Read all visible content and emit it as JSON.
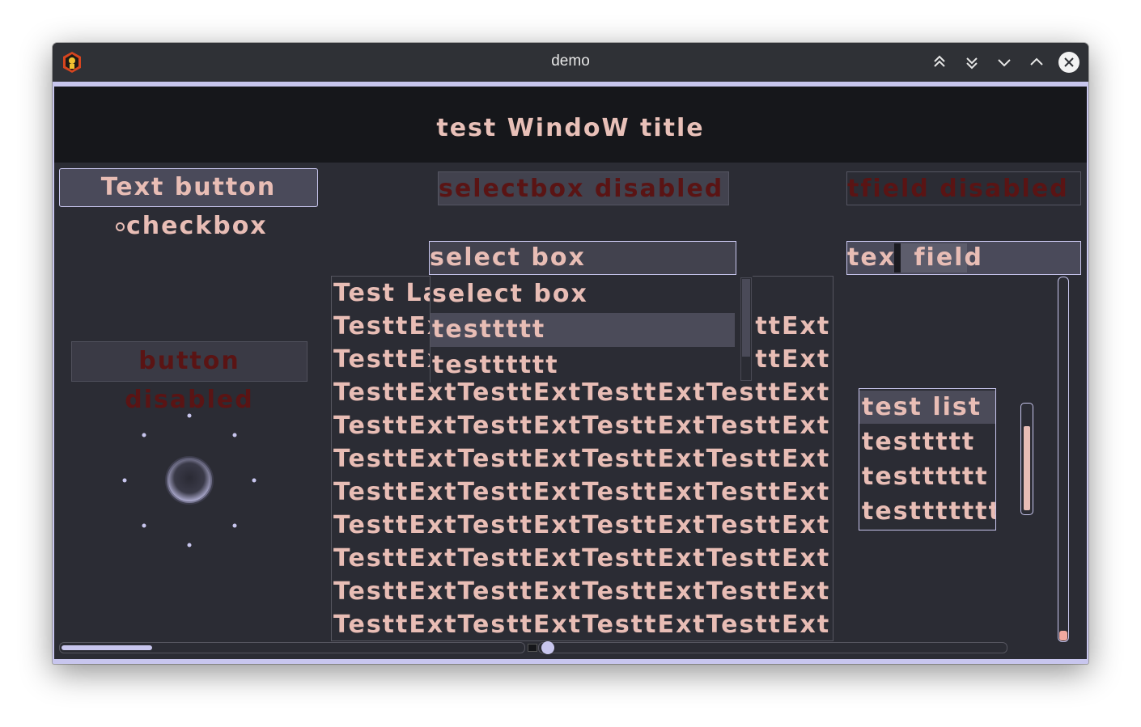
{
  "window": {
    "title": "demo",
    "controls": [
      "keep-above-icon",
      "keep-below-icon",
      "minimize-icon",
      "maximize-icon",
      "close-icon"
    ]
  },
  "header": {
    "title": "test WindoW title"
  },
  "text_button": {
    "label": "Text button"
  },
  "checkbox": {
    "label": "checkbox",
    "checked": false
  },
  "button_disabled": {
    "label": "button disabled"
  },
  "selectbox_disabled": {
    "value": "selectbox disabled"
  },
  "tfield_disabled": {
    "value": "tfield disabled"
  },
  "select_box": {
    "value": "select box",
    "options": [
      "select box",
      "testtttt",
      "testttttt"
    ]
  },
  "text_field": {
    "value": "text field",
    "visible_left": "tex",
    "visible_right": " field"
  },
  "text_area": {
    "lines": [
      "Test La",
      "TesttExtTesttExtTesttExtTesttExt",
      "TesttExtTesttExtTesttExtTesttExt",
      "TesttExtTesttExtTesttExtTesttExt",
      "TesttExtTesttExtTesttExtTesttExt",
      "TesttExtTesttExtTesttExtTesttExt",
      "TesttExtTesttExtTesttExtTesttExt",
      "TesttExtTesttExtTesttExtTesttExt",
      "TesttExtTesttExtTesttExtTesttExt",
      "TesttExtTesttExtTesttExtTesttExt",
      "TesttExtTesttExtTesttExtTesttExt"
    ]
  },
  "test_list": {
    "items": [
      "test list",
      "testtttt",
      "testttttt",
      "testtttttt"
    ]
  },
  "colors": {
    "text": "#e8bdb5",
    "accent": "#c8c6ee",
    "disabled_text": "#5a1414",
    "background": "#2b2c34",
    "header_bg": "#16171b"
  }
}
